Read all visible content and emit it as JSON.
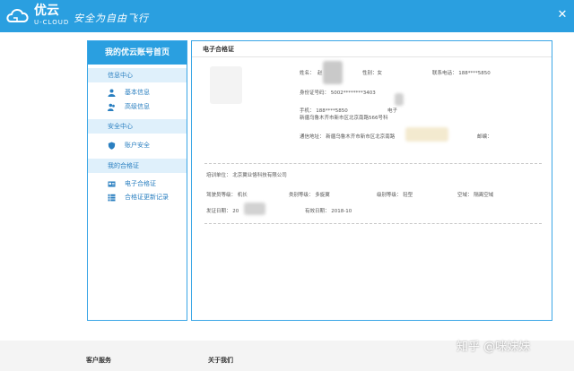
{
  "header": {
    "brand": "优云",
    "brand_sub": "U-CLOUD",
    "slogan": "安全为自由飞行",
    "bg_color": "#2a9fe0"
  },
  "sidebar": {
    "title": "我的优云账号首页",
    "sections": [
      {
        "label": "信息中心",
        "items": [
          {
            "label": "基本信息",
            "icon": "user-icon"
          },
          {
            "label": "高级信息",
            "icon": "users-icon"
          }
        ]
      },
      {
        "label": "安全中心",
        "items": [
          {
            "label": "账户安全",
            "icon": "shield-icon"
          }
        ]
      },
      {
        "label": "我的合格证",
        "items": [
          {
            "label": "电子合格证",
            "icon": "id-card-icon"
          },
          {
            "label": "合格证更新记录",
            "icon": "list-icon"
          }
        ]
      }
    ]
  },
  "certificate": {
    "title": "电子合格证",
    "name_label": "姓名：",
    "name_value": "赵",
    "gender": "性别：女",
    "phone": "联系电话： 188****5850",
    "id_number": "身份证号码： 5002********3403",
    "mobile": "手机： 188****5850",
    "email_label": "电子",
    "address1": "新疆乌鲁木齐市新市区北京南路566号科",
    "mail_address": "通信地址： 新疆乌鲁木齐市新市区北京南路",
    "postcode": "邮编：",
    "training_unit": "培训单位： 北京翼业恪科技有限公司",
    "pilot_level": "驾驶员等级： 机长",
    "class_level": "类别等级： 多旋翼",
    "grade_level": "级别等级： 轻型",
    "airspace": "空域： 隔离空域",
    "issue_date": "发证日期： 20",
    "valid_date": "有效日期： 2018-10"
  },
  "footer": {
    "customer_service": "客户服务",
    "about_us": "关于我们"
  },
  "watermark": "知乎 @咪妹妹"
}
